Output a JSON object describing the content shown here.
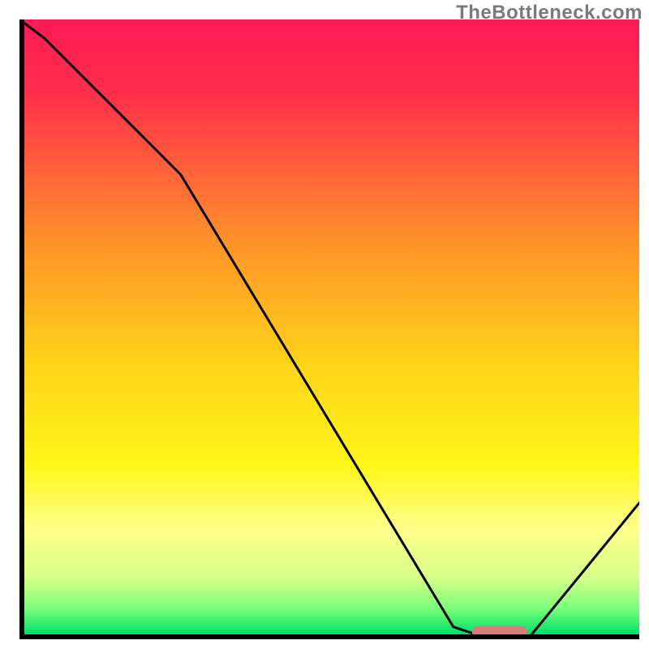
{
  "watermark": "TheBottleneck.com",
  "chart_data": {
    "type": "line",
    "title": "",
    "xlabel": "",
    "ylabel": "",
    "xlim": [
      0,
      100
    ],
    "ylim": [
      0,
      100
    ],
    "x": [
      0,
      4,
      26,
      70,
      76,
      82,
      100
    ],
    "values": [
      100,
      97,
      75,
      2,
      0,
      0,
      22
    ],
    "highlight_x_range": [
      73,
      82
    ],
    "gradient_stops": [
      {
        "pos": 0,
        "color": "#ff1a55"
      },
      {
        "pos": 12,
        "color": "#ff2f4a"
      },
      {
        "pos": 35,
        "color": "#ff8f2a"
      },
      {
        "pos": 55,
        "color": "#ffd21a"
      },
      {
        "pos": 72,
        "color": "#fff61a"
      },
      {
        "pos": 82,
        "color": "#ffff8a"
      },
      {
        "pos": 90,
        "color": "#d8ff8a"
      },
      {
        "pos": 95,
        "color": "#7bff7b"
      },
      {
        "pos": 99,
        "color": "#05e06a"
      },
      {
        "pos": 100,
        "color": "#05e06a"
      }
    ],
    "curve_color": "#000000",
    "marker_color": "#d97b7d"
  }
}
